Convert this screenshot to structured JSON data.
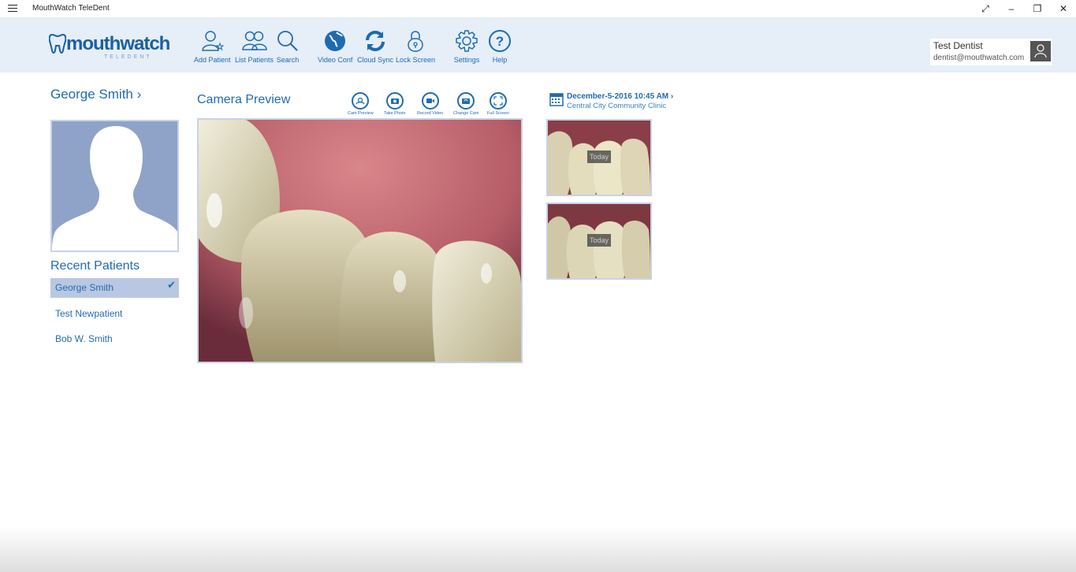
{
  "window": {
    "title": "MouthWatch TeleDent",
    "menu_icon": "hamburger-icon",
    "controls": [
      "expand-icon",
      "minimize-icon",
      "restore-icon",
      "close-icon"
    ]
  },
  "header": {
    "logo_text": "mouthwatch",
    "logo_sub": "TELEDENT",
    "toolbar": [
      {
        "label": "Add Patient",
        "icon": "add-patient-icon"
      },
      {
        "label": "List Patients",
        "icon": "list-patients-icon"
      },
      {
        "label": "Search",
        "icon": "search-icon"
      },
      {
        "label": "Video Conf",
        "icon": "globe-icon"
      },
      {
        "label": "Cloud Sync",
        "icon": "sync-icon"
      },
      {
        "label": "Lock Screen",
        "icon": "lock-icon"
      },
      {
        "label": "Settings",
        "icon": "gear-icon"
      },
      {
        "label": "Help",
        "icon": "help-icon"
      }
    ],
    "user": {
      "name": "Test Dentist",
      "email": "dentist@mouthwatch.com",
      "avatar_icon": "user-icon"
    }
  },
  "patient": {
    "name": "George  Smith  ›"
  },
  "recent": {
    "title": "Recent Patients",
    "items": [
      {
        "name": "George  Smith",
        "selected": true
      },
      {
        "name": "Test  Newpatient",
        "selected": false
      },
      {
        "name": "Bob W. Smith",
        "selected": false
      }
    ]
  },
  "camera": {
    "title": "Camera Preview",
    "tools": [
      {
        "label": "Cam Preview",
        "icon": "cam-preview-icon"
      },
      {
        "label": "Take Photo",
        "icon": "camera-icon"
      },
      {
        "label": "Record Video",
        "icon": "video-icon"
      },
      {
        "label": "Change Cam",
        "icon": "switch-camera-icon"
      },
      {
        "label": "Full Screen",
        "icon": "fullscreen-icon"
      }
    ]
  },
  "session": {
    "date": "December-5-2016 10:45 AM ›",
    "clinic": "Central City Community Clinic",
    "thumbnails": [
      {
        "tag": "Today"
      },
      {
        "tag": "Today"
      }
    ]
  },
  "colors": {
    "accent": "#1f6bb0",
    "header_bg": "#e6eef8",
    "selected_row": "#b9c7e3"
  }
}
